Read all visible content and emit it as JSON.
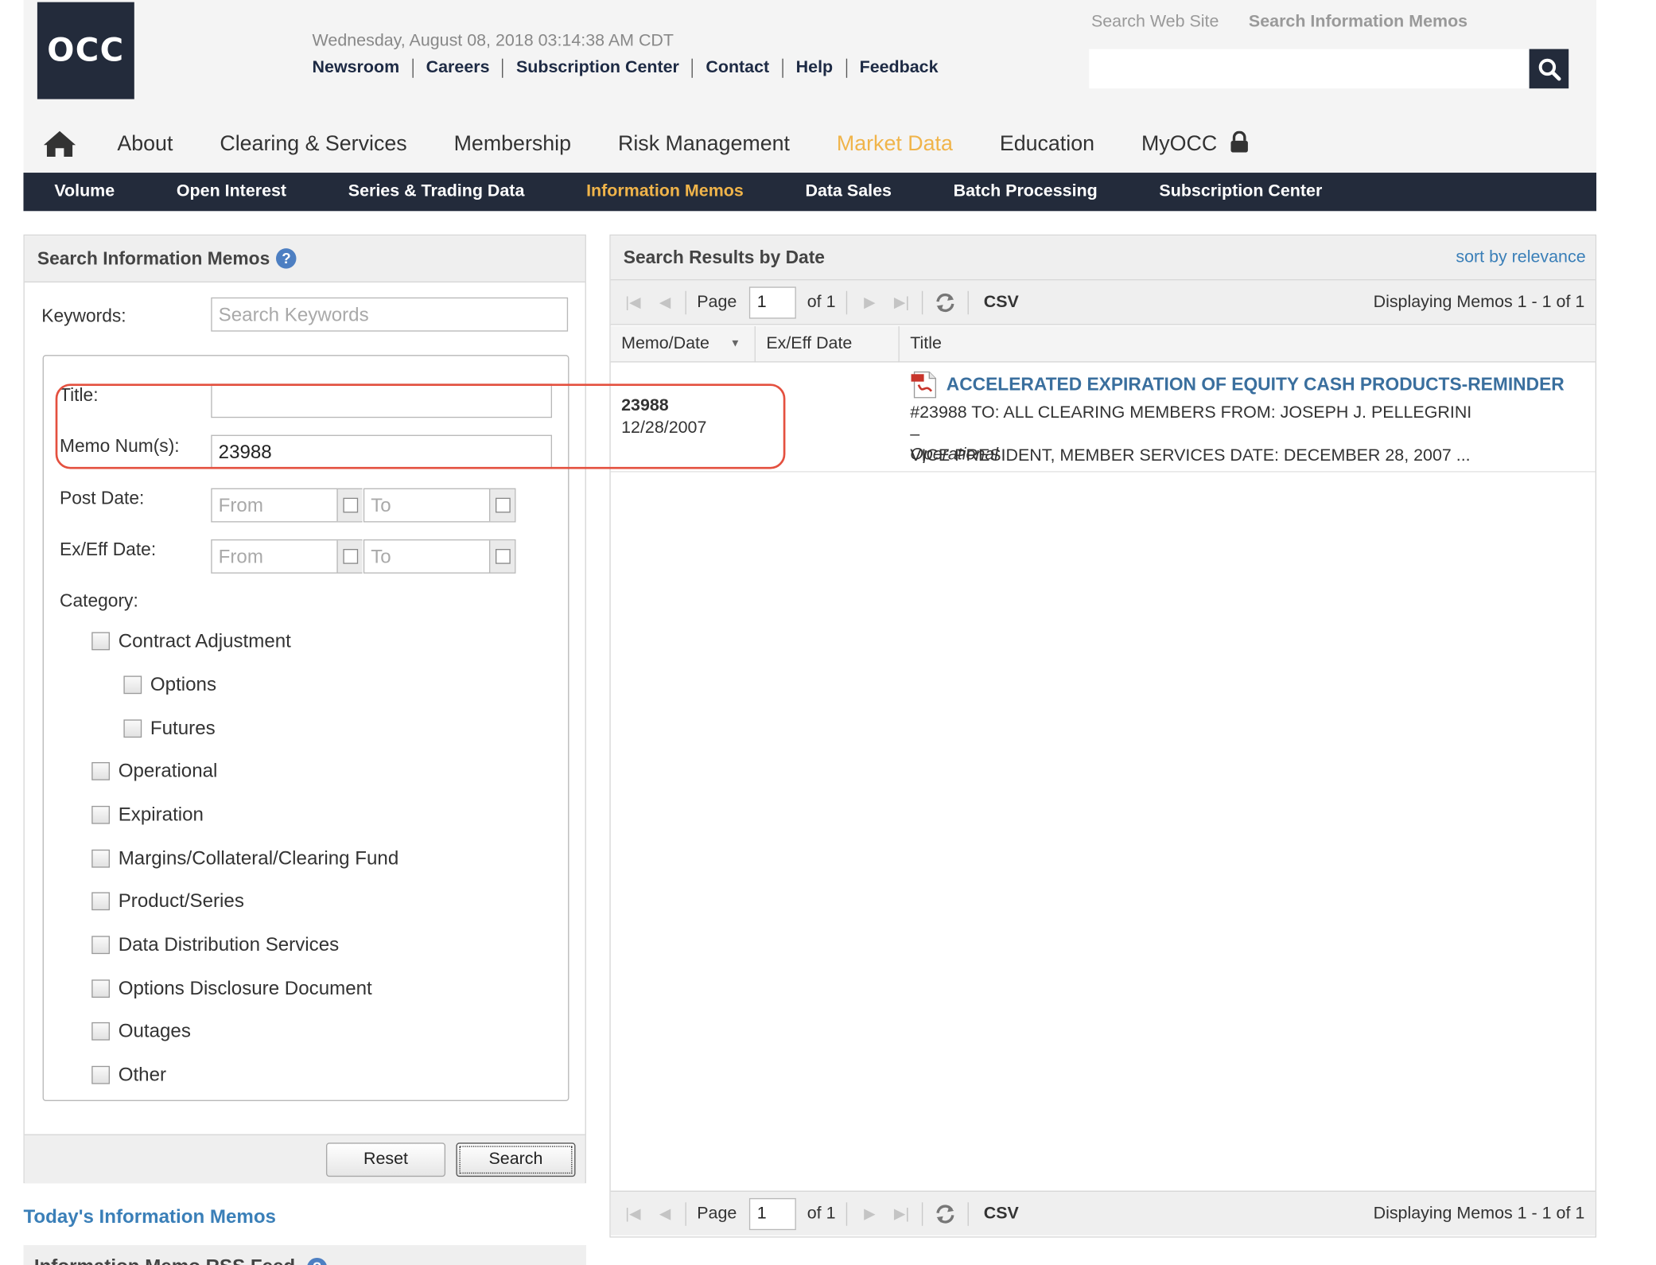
{
  "header": {
    "logo_text": "OCC",
    "datetime": "Wednesday, August 08, 2018 03:14:38 AM CDT",
    "utility_links": [
      "Newsroom",
      "Careers",
      "Subscription Center",
      "Contact",
      "Help",
      "Feedback"
    ],
    "search_tabs": [
      "Search Web Site",
      "Search Information Memos"
    ],
    "search_value": ""
  },
  "main_nav": {
    "items": [
      "About",
      "Clearing & Services",
      "Membership",
      "Risk Management",
      "Market Data",
      "Education",
      "MyOCC"
    ],
    "active": "Market Data"
  },
  "sub_nav": {
    "items": [
      "Volume",
      "Open Interest",
      "Series & Trading Data",
      "Information Memos",
      "Data Sales",
      "Batch Processing",
      "Subscription Center"
    ],
    "active": "Information Memos"
  },
  "search_panel": {
    "title": "Search Information Memos",
    "help": "?",
    "keywords_label": "Keywords:",
    "keywords_placeholder": "Search Keywords",
    "title_label": "Title:",
    "title_value": "",
    "memo_label": "Memo Num(s):",
    "memo_value": "23988",
    "post_date_label": "Post Date:",
    "exeff_date_label": "Ex/Eff Date:",
    "from_placeholder": "From",
    "to_placeholder": "To",
    "category_label": "Category:",
    "categories": [
      "Contract Adjustment",
      "Options",
      "Futures",
      "Operational",
      "Expiration",
      "Margins/Collateral/Clearing Fund",
      "Product/Series",
      "Data Distribution Services",
      "Options Disclosure Document",
      "Outages",
      "Other"
    ],
    "reset_label": "Reset",
    "search_label": "Search"
  },
  "today_link": "Today's Information Memos",
  "rss_title": "Information Memo RSS Feed",
  "results": {
    "title": "Search Results by Date",
    "sort_link": "sort by relevance",
    "pager": {
      "page_label": "Page",
      "page_value": "1",
      "of_label": "of 1",
      "csv_label": "CSV",
      "display": "Displaying Memos 1 - 1 of 1"
    },
    "columns": [
      "Memo/Date",
      "Ex/Eff Date",
      "Title"
    ],
    "rows": [
      {
        "memo": "23988",
        "date": "12/28/2007",
        "title": "ACCELERATED EXPIRATION OF EQUITY CASH PRODUCTS-REMINDER",
        "summary_line1": "#23988 TO: ALL CLEARING MEMBERS FROM: JOSEPH J. PELLEGRINI –",
        "summary_line2": "VICE PRESIDENT, MEMBER SERVICES DATE: DECEMBER 28, 2007 ...",
        "category": "Operational"
      }
    ]
  }
}
